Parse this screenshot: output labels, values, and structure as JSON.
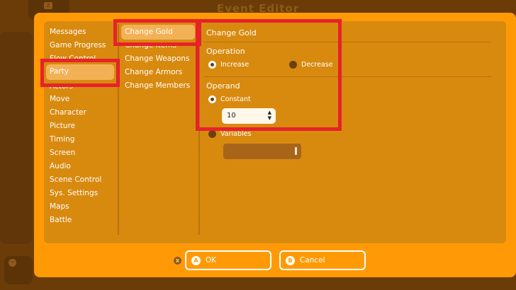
{
  "window": {
    "title": "Event Editor"
  },
  "categories": [
    "Messages",
    "Game Progress",
    "Flow Control",
    "Party",
    "Actors",
    "Move",
    "Character",
    "Picture",
    "Timing",
    "Screen",
    "Audio",
    "Scene Control",
    "Sys. Settings",
    "Maps",
    "Battle"
  ],
  "selected_category": "Party",
  "commands": [
    "Change Gold",
    "Change Items",
    "Change Weapons",
    "Change Armors",
    "Change Members"
  ],
  "selected_command": "Change Gold",
  "detail": {
    "title": "Change Gold",
    "operation": {
      "label": "Operation",
      "options": [
        "Increase",
        "Decrease"
      ],
      "selected": "Increase"
    },
    "operand": {
      "label": "Operand",
      "options": [
        "Constant",
        "Variables"
      ],
      "selected": "Constant",
      "constant_value": "10"
    }
  },
  "footer": {
    "x_glyph": "X",
    "ok": {
      "glyph": "A",
      "label": "OK"
    },
    "cancel": {
      "glyph": "B",
      "label": "Cancel"
    }
  },
  "background": {
    "corner_glyph": "Z",
    "minus_glyph": "−"
  },
  "colors": {
    "dialog": "#ff9a06",
    "panel": "#d88a0f",
    "selection": "#f2b155",
    "highlight_box": "#e8212b"
  }
}
